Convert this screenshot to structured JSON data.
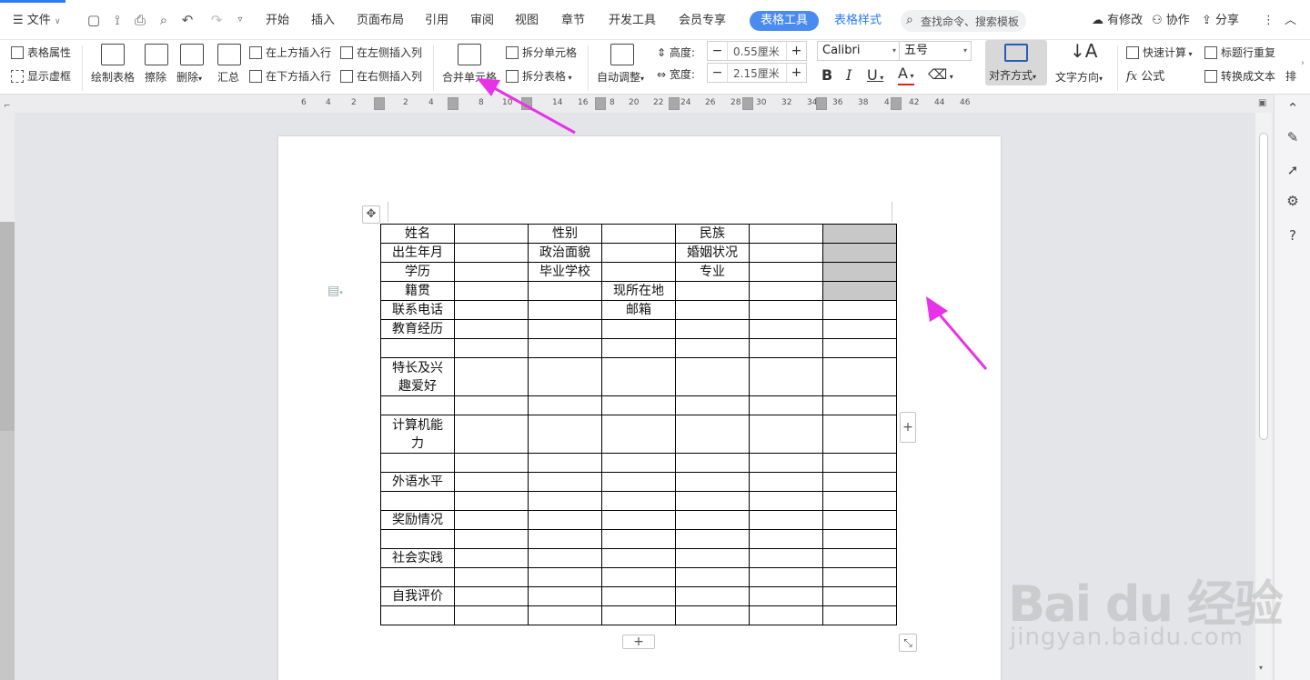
{
  "topbar": {
    "file_menu": "文件",
    "tabs": [
      "开始",
      "插入",
      "页面布局",
      "引用",
      "审阅",
      "视图",
      "章节",
      "开发工具",
      "会员专享"
    ],
    "active_tab": "表格工具",
    "tab_table_style": "表格样式",
    "search_placeholder": "查找命令、搜索模板",
    "modified": "有修改",
    "collab": "协作",
    "share": "分享"
  },
  "ribbon": {
    "table_props": "表格属性",
    "show_gridlines": "显示虚框",
    "draw_table": "绘制表格",
    "erase": "擦除",
    "delete": "删除",
    "summary": "汇总",
    "insert_row_above": "在上方插入行",
    "insert_row_below": "在下方插入行",
    "insert_col_left": "在左侧插入列",
    "insert_col_right": "在右侧插入列",
    "merge_cells": "合并单元格",
    "split_cells": "拆分单元格",
    "split_table": "拆分表格",
    "auto_adjust": "自动调整",
    "height_label": "高度:",
    "height_value": "0.55厘米",
    "width_label": "宽度:",
    "width_value": "2.15厘米",
    "font_name": "Calibri",
    "font_size": "五号",
    "align": "对齐方式",
    "text_direction": "文字方向",
    "quick_calc": "快速计算",
    "formula": "公式",
    "title_repeat": "标题行重复",
    "to_text": "转换成文本",
    "overflow": "排"
  },
  "ruler": {
    "ticks": [
      "6",
      "4",
      "2",
      "2",
      "4",
      "8",
      "10",
      "14",
      "16",
      "8",
      "20",
      "22",
      "24",
      "26",
      "28",
      "30",
      "32",
      "34",
      "36",
      "38",
      "4",
      "42",
      "44",
      "46"
    ]
  },
  "table": {
    "rows": [
      {
        "cells": [
          "姓名",
          "",
          "性别",
          "",
          "民族",
          "",
          ""
        ],
        "grey": [
          6
        ],
        "tall": false
      },
      {
        "cells": [
          "出生年月",
          "",
          "政治面貌",
          "",
          "婚姻状况",
          "",
          ""
        ],
        "grey": [
          6
        ],
        "tall": false
      },
      {
        "cells": [
          "学历",
          "",
          "毕业学校",
          "",
          "专业",
          "",
          ""
        ],
        "grey": [
          6
        ],
        "tall": false
      },
      {
        "cells": [
          "籍贯",
          "",
          "",
          "现所在地",
          "",
          "",
          ""
        ],
        "grey": [
          6
        ],
        "tall": false
      },
      {
        "cells": [
          "联系电话",
          "",
          "",
          "邮箱",
          "",
          "",
          ""
        ],
        "grey": [],
        "tall": false
      },
      {
        "cells": [
          "教育经历",
          "",
          "",
          "",
          "",
          "",
          ""
        ],
        "grey": [],
        "tall": false
      },
      {
        "cells": [
          "",
          "",
          "",
          "",
          "",
          "",
          ""
        ],
        "grey": [],
        "tall": false
      },
      {
        "cells": [
          "特长及兴趣爱好",
          "",
          "",
          "",
          "",
          "",
          ""
        ],
        "grey": [],
        "tall": true
      },
      {
        "cells": [
          "",
          "",
          "",
          "",
          "",
          "",
          ""
        ],
        "grey": [],
        "tall": false
      },
      {
        "cells": [
          "计算机能力",
          "",
          "",
          "",
          "",
          "",
          ""
        ],
        "grey": [],
        "tall": true
      },
      {
        "cells": [
          "",
          "",
          "",
          "",
          "",
          "",
          ""
        ],
        "grey": [],
        "tall": false
      },
      {
        "cells": [
          "外语水平",
          "",
          "",
          "",
          "",
          "",
          ""
        ],
        "grey": [],
        "tall": false
      },
      {
        "cells": [
          "",
          "",
          "",
          "",
          "",
          "",
          ""
        ],
        "grey": [],
        "tall": false
      },
      {
        "cells": [
          "奖励情况",
          "",
          "",
          "",
          "",
          "",
          ""
        ],
        "grey": [],
        "tall": false
      },
      {
        "cells": [
          "",
          "",
          "",
          "",
          "",
          "",
          ""
        ],
        "grey": [],
        "tall": false
      },
      {
        "cells": [
          "社会实践",
          "",
          "",
          "",
          "",
          "",
          ""
        ],
        "grey": [],
        "tall": false
      },
      {
        "cells": [
          "",
          "",
          "",
          "",
          "",
          "",
          ""
        ],
        "grey": [],
        "tall": false
      },
      {
        "cells": [
          "自我评价",
          "",
          "",
          "",
          "",
          "",
          ""
        ],
        "grey": [],
        "tall": false
      },
      {
        "cells": [
          "",
          "",
          "",
          "",
          "",
          "",
          ""
        ],
        "grey": [],
        "tall": false
      }
    ]
  },
  "watermark": {
    "main": "Bai du 经验",
    "sub": "jingyan.baidu.com"
  },
  "colors": {
    "accent": "#2b7bf2",
    "annotation_arrow": "#e832e8",
    "selected_cell": "#c8c8c8"
  }
}
